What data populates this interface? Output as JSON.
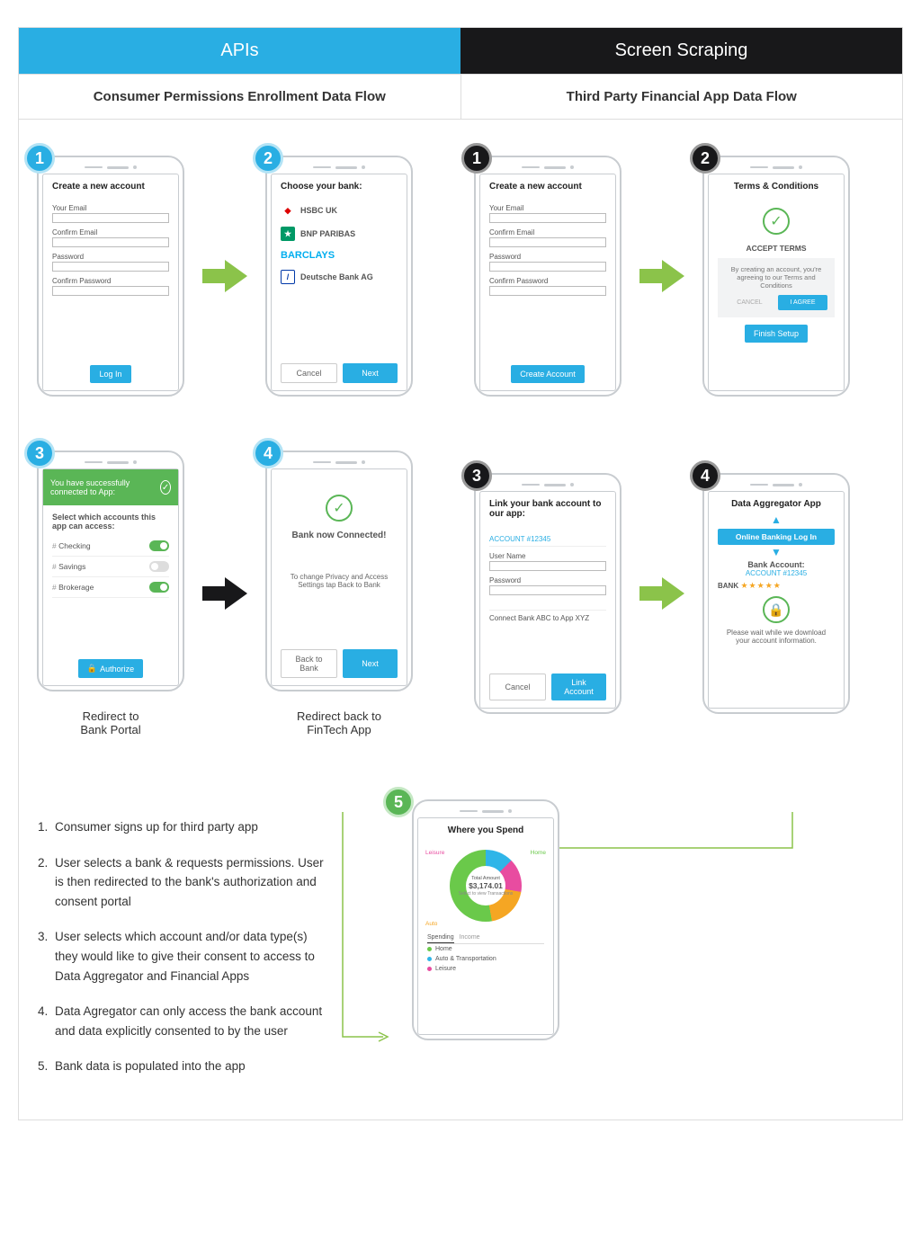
{
  "tabs": {
    "apis": "APIs",
    "scraping": "Screen Scraping"
  },
  "subtitles": {
    "left": "Consumer Permissions Enrollment Data Flow",
    "right": "Third Party Financial App Data Flow"
  },
  "phone1": {
    "title": "Create a new account",
    "email": "Your Email",
    "confirmEmail": "Confirm Email",
    "password": "Password",
    "confirmPassword": "Confirm Password",
    "login": "Log In"
  },
  "phone2": {
    "title": "Choose your bank:",
    "banks": [
      "HSBC UK",
      "BNP PARIBAS",
      "BARCLAYS",
      "Deutsche Bank AG"
    ],
    "cancel": "Cancel",
    "next": "Next"
  },
  "phone3": {
    "banner": "You have successfully connected to App:",
    "subtitle": "Select which accounts this app can access:",
    "accounts": [
      {
        "name": "Checking",
        "on": true
      },
      {
        "name": "Savings",
        "on": false
      },
      {
        "name": "Brokerage",
        "on": true
      }
    ],
    "authorize": "Authorize"
  },
  "phone4": {
    "connected": "Bank now Connected!",
    "note": "To change Privacy and Access Settings tap Back to Bank",
    "back": "Back to Bank",
    "next": "Next"
  },
  "phoneR1": {
    "title": "Create a new account",
    "email": "Your Email",
    "confirmEmail": "Confirm Email",
    "password": "Password",
    "confirmPassword": "Confirm Password",
    "create": "Create Account"
  },
  "phoneR2": {
    "title": "Terms & Conditions",
    "accept": "ACCEPT TERMS",
    "note": "By creating an account, you're agreeing to our Terms and Conditions",
    "cancel": "CANCEL",
    "agree": "I AGREE",
    "finish": "Finish Setup"
  },
  "phoneR3": {
    "title": "Link your bank account to our app:",
    "account": "ACCOUNT #12345",
    "username": "User Name",
    "password": "Password",
    "connect": "Connect Bank ABC to App XYZ",
    "cancel": "Cancel",
    "link": "Link Account"
  },
  "phoneR4": {
    "title": "Data Aggregator App",
    "onlineBanking": "Online Banking Log In",
    "bankAccount": "Bank Account:",
    "accountNum": "ACCOUNT #12345",
    "bank": "BANK",
    "wait": "Please wait while we download your account information."
  },
  "captions": {
    "c3": "Redirect to\nBank Portal",
    "c4": "Redirect back to\nFinTech App"
  },
  "phone5": {
    "title": "Where you Spend",
    "totalLabel": "Total Amount",
    "total": "$3,174.01",
    "select": "Select to view Transactions",
    "tabs": {
      "spending": "Spending",
      "income": "Income"
    },
    "legend": [
      {
        "label": "Home",
        "color": "#6ac94a"
      },
      {
        "label": "Auto & Transportation",
        "color": "#2fb5e8"
      },
      {
        "label": "Leisure",
        "color": "#e84ca0"
      }
    ],
    "labels": {
      "leisure": "Leisure",
      "home": "Home",
      "auto": "Auto"
    }
  },
  "steps": [
    "Consumer signs up for third party app",
    "User selects a bank & requests permissions. User is then redirected to the bank's authorization and consent portal",
    "User selects which account and/or data type(s) they would like to give their consent to access to Data Aggregator and Financial Apps",
    "Data Agregator can only access the bank account and data explicitly consented to by the user",
    "Bank data is populated into the app"
  ]
}
